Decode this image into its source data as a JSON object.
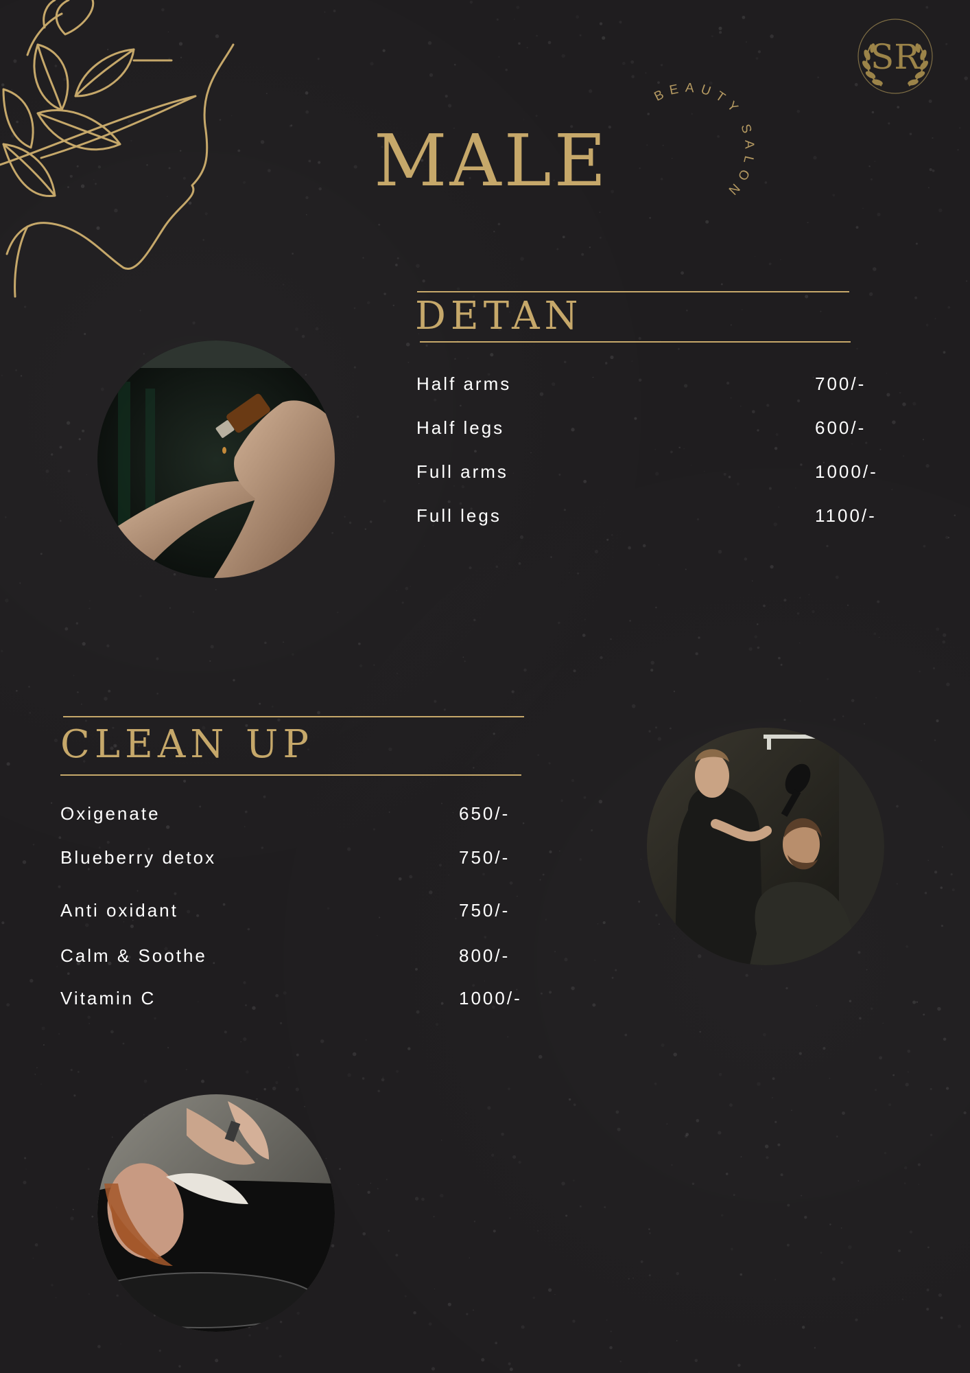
{
  "colors": {
    "background": "#1f1d1f",
    "gold": "#c6a86a",
    "text": "#ffffff"
  },
  "header": {
    "title": "MALE",
    "brand_arc": "BEAUTY SALON",
    "monogram": "SR"
  },
  "detan": {
    "title": "DETAN",
    "items": [
      {
        "name": "Half arms",
        "price": "700/-"
      },
      {
        "name": "Half legs",
        "price": "600/-"
      },
      {
        "name": "Full arms",
        "price": "1000/-"
      },
      {
        "name": "Full legs",
        "price": "1100/-"
      }
    ]
  },
  "cleanup": {
    "title": "CLEAN UP",
    "items": [
      {
        "name": "Oxigenate",
        "price": "650/-"
      },
      {
        "name": "Blueberry detox",
        "price": "750/-"
      },
      {
        "name": "Anti oxidant",
        "price": "750/-"
      },
      {
        "name": "Calm & Soothe",
        "price": "800/-"
      },
      {
        "name": "Vitamin C",
        "price": "1000/-"
      }
    ]
  },
  "icons": {
    "floral": "floral-face-line-art-icon",
    "laurel": "laurel-wreath-icon"
  }
}
